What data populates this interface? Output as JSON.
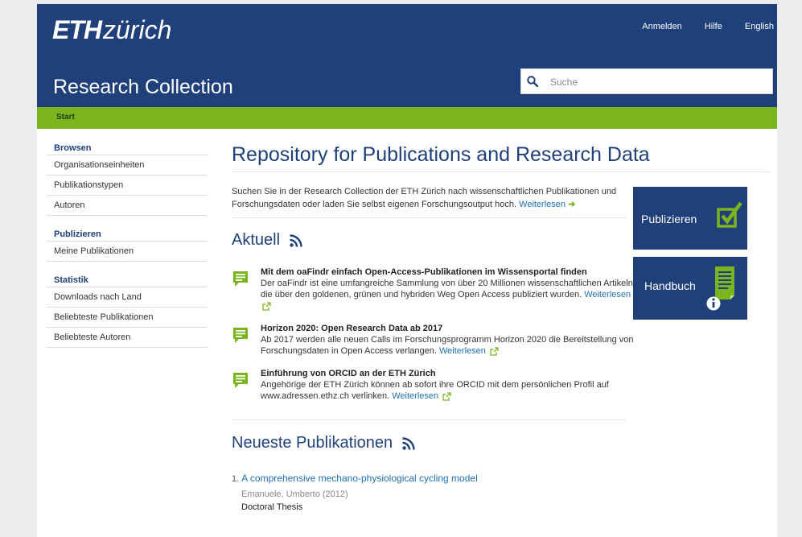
{
  "header": {
    "logo_eth": "ETH",
    "logo_zurich": "zürich",
    "links": [
      "Anmelden",
      "Hilfe",
      "English"
    ],
    "title": "Research Collection",
    "search_placeholder": "Suche",
    "bg_color": "#1f407a"
  },
  "breadcrumb": {
    "label": "Start",
    "bar_color": "#7ab51d"
  },
  "sidebar": {
    "browse_heading": "Browsen",
    "browse_items": [
      "Organisationseinheiten",
      "Publikationstypen",
      "Autoren"
    ],
    "publish_heading": "Publizieren",
    "publish_items": [
      "Meine Publikationen"
    ],
    "stats_heading": "Statistik",
    "stats_items": [
      "Downloads nach Land",
      "Beliebteste Publikationen",
      "Beliebteste Autoren"
    ]
  },
  "main": {
    "title": "Repository for Publications and Research Data",
    "intro": "Suchen Sie in der Research Collection der ETH Zürich nach wissenschaftlichen Publikationen und Forschungsdaten oder laden Sie selbst eigenen Forschungsoutput hoch.",
    "intro_more": "Weiterlesen",
    "news_heading": "Aktuell",
    "news": [
      {
        "title": "Mit dem oaFindr einfach Open-Access-Publikationen im Wissensportal finden",
        "body": "Der oaFindr ist eine umfangreiche Sammlung von über 20 Millionen wissenschaftlichen Artikeln, die über den goldenen, grünen und hybriden Weg Open Access publiziert wurden.",
        "more": "Weiterlesen"
      },
      {
        "title": "Horizon 2020: Open Research Data ab 2017",
        "body": "Ab 2017 werden alle neuen Calls im Forschungsprogramm Horizon 2020 die Bereitstellung von Forschungsdaten in Open Access verlangen.",
        "more": "Weiterlesen"
      },
      {
        "title": "Einführung von ORCID an der ETH Zürich",
        "body": "Angehörige der ETH Zürich können ab sofort ihre ORCID mit dem persönlichen Profil auf www.adressen.ethz.ch verlinken.",
        "more": "Weiterlesen"
      }
    ],
    "latest_heading": "Neueste Publikationen",
    "publications": [
      {
        "number": "1.",
        "title": "A comprehensive mechano-physiological cycling model",
        "author": "Emanuele, Umberto (2012)",
        "type": "Doctoral Thesis"
      }
    ]
  },
  "tiles": {
    "publish_label": "Publizieren",
    "handbook_label": "Handbuch",
    "accent_green": "#7ab51d"
  }
}
